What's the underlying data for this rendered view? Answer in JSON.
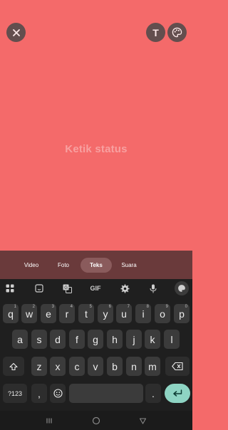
{
  "top_actions": {
    "close_icon": "close-icon",
    "text_label": "T",
    "palette_icon": "palette-icon"
  },
  "placeholder": "Ketik status",
  "colors": {
    "canvas_bg": "#f46a6a",
    "mode_bar_bg": "#6a3a3b",
    "keyboard_bg": "#1f1f1f",
    "enter_key": "#8ed4c3"
  },
  "modes": [
    {
      "label": "Video",
      "active": false
    },
    {
      "label": "Foto",
      "active": false
    },
    {
      "label": "Teks",
      "active": true
    },
    {
      "label": "Suara",
      "active": false
    }
  ],
  "keyboard_toolbar": {
    "gif_label": "GIF",
    "icons": [
      "apps-grid-icon",
      "sticker-icon",
      "translate-icon",
      "gif",
      "settings-gear-icon",
      "microphone-icon",
      "palette-icon"
    ]
  },
  "keys": {
    "row1": [
      {
        "label": "q",
        "hint": "1"
      },
      {
        "label": "w",
        "hint": "2"
      },
      {
        "label": "e",
        "hint": "3"
      },
      {
        "label": "r",
        "hint": "4"
      },
      {
        "label": "t",
        "hint": "5"
      },
      {
        "label": "y",
        "hint": "6"
      },
      {
        "label": "u",
        "hint": "7"
      },
      {
        "label": "i",
        "hint": "8"
      },
      {
        "label": "o",
        "hint": "9"
      },
      {
        "label": "p",
        "hint": "0"
      }
    ],
    "row2": [
      "a",
      "s",
      "d",
      "f",
      "g",
      "h",
      "j",
      "k",
      "l"
    ],
    "row3": [
      "z",
      "x",
      "c",
      "v",
      "b",
      "n",
      "m"
    ],
    "symbols_label": "?123",
    "comma_label": ",",
    "period_label": "."
  }
}
